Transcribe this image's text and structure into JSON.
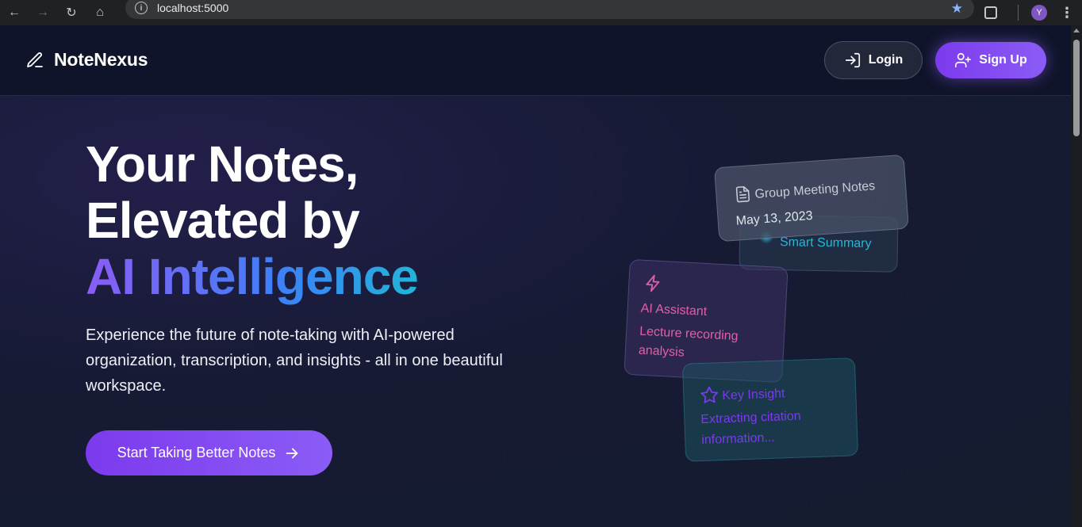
{
  "browser": {
    "url": "localhost:5000",
    "profile_initial": "Y",
    "icons": [
      "back-arrow-icon",
      "forward-arrow-icon",
      "reload-icon",
      "home-icon",
      "site-info-icon",
      "bookmark-star-icon",
      "extensions-icon",
      "more-menu-icon"
    ]
  },
  "header": {
    "brand": "NoteNexus",
    "login_label": "Login",
    "signup_label": "Sign Up"
  },
  "hero": {
    "title_line1": "Your Notes,",
    "title_line2": "Elevated by",
    "title_highlight": "AI Intelligence",
    "description": "Experience the future of note-taking with AI-powered organization, transcription, and insights - all in one beautiful workspace.",
    "cta_label": "Start Taking Better Notes"
  },
  "cards": {
    "meeting": {
      "title": "Group Meeting Notes",
      "date": "May 13, 2023"
    },
    "summary": {
      "label": "Smart Summary"
    },
    "ai": {
      "title": "AI Assistant",
      "text": "Lecture recording analysis"
    },
    "insight": {
      "title": "Key Insight",
      "text": "Extracting citation information..."
    }
  },
  "colors": {
    "accent_purple": "#8b5cf6",
    "pink": "#e25fa8",
    "cyan": "#22b8d8",
    "background": "#161a33"
  }
}
